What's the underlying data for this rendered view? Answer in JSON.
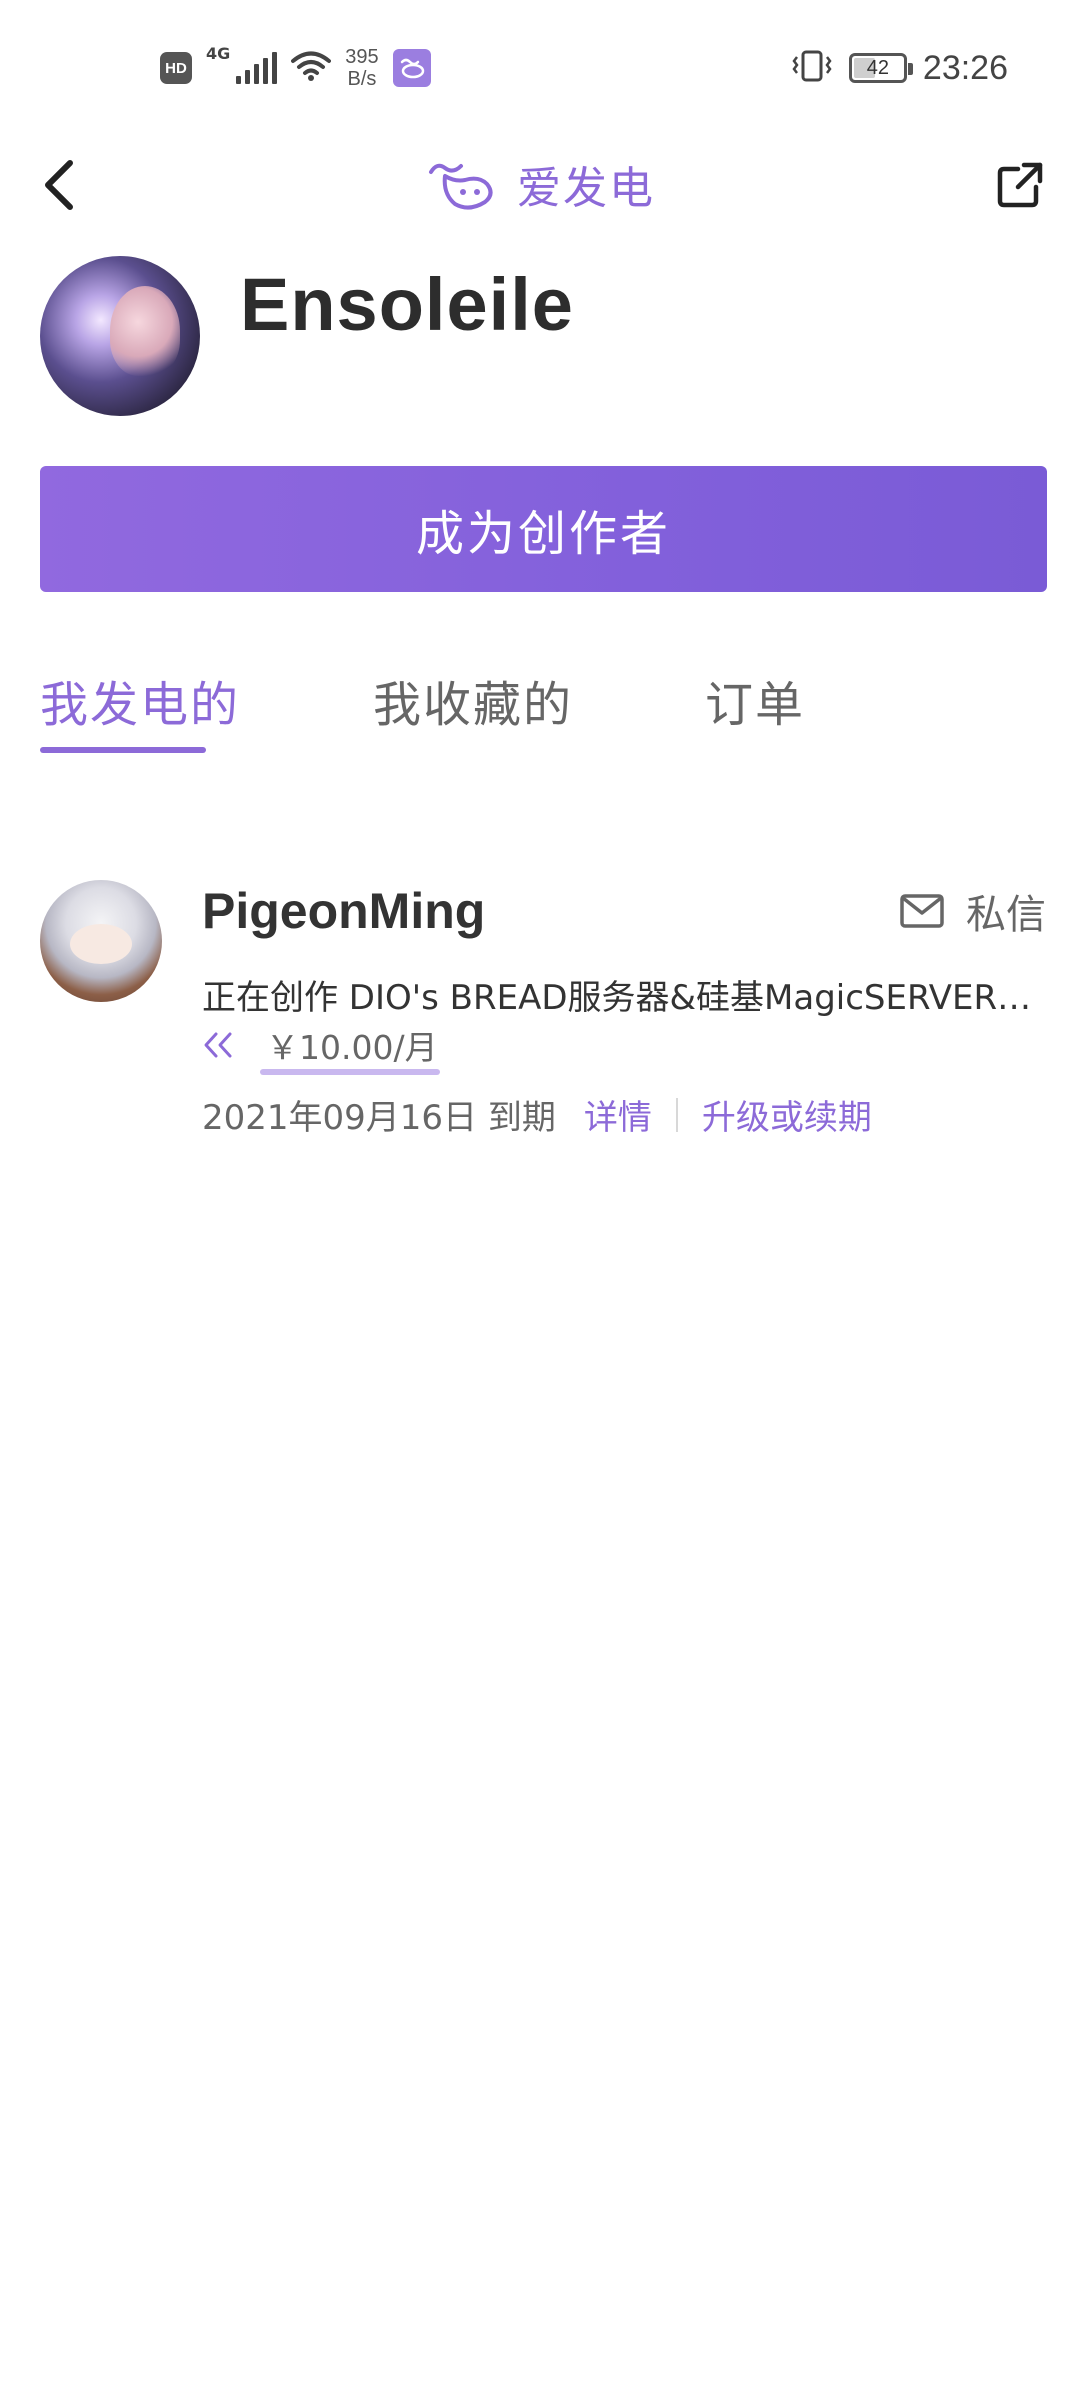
{
  "status_bar": {
    "hd": "HD",
    "network_type": "4G",
    "speed_value": "395",
    "speed_unit": "B/s",
    "battery": "42",
    "time": "23:26",
    "icons": [
      "hd-icon",
      "signal-icon",
      "wifi-icon",
      "app-notification-icon",
      "vibrate-icon",
      "battery-icon"
    ]
  },
  "nav": {
    "title": "爱发电",
    "back_icon": "chevron-left-icon",
    "logo_icon": "afdian-logo-icon",
    "share_icon": "external-share-icon"
  },
  "profile": {
    "name": "Ensoleile"
  },
  "creator_button": {
    "label": "成为创作者"
  },
  "tabs": [
    {
      "label": "我发电的",
      "active": true
    },
    {
      "label": "我收藏的",
      "active": false
    },
    {
      "label": "订单",
      "active": false
    }
  ],
  "sponsorships": [
    {
      "name": "PigeonMing",
      "message_label": "私信",
      "message_icon": "mail-icon",
      "description": "正在创作 DIO's BREAD服务器&硅基MagicSERVER服务器",
      "price_icon": "double-chevron-left-icon",
      "price": "￥10.00/月",
      "expiry": "2021年09月16日 到期",
      "details_label": "详情",
      "renew_label": "升级或续期"
    }
  ],
  "colors": {
    "accent": "#8c6ad8",
    "button_gradient_start": "#9169df",
    "button_gradient_end": "#7a5bd6",
    "text_primary": "#333333",
    "text_secondary": "#666666"
  }
}
